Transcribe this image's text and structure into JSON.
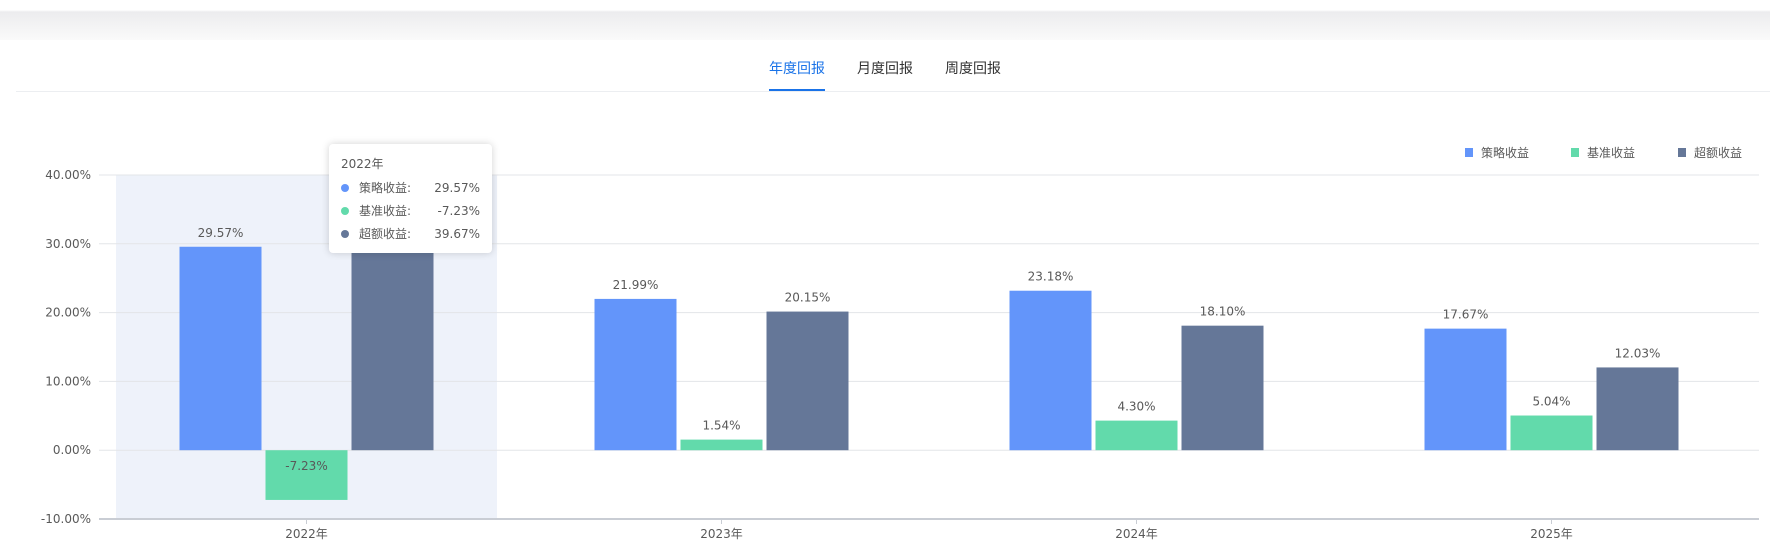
{
  "tabs": [
    {
      "label": "年度回报",
      "active": true
    },
    {
      "label": "月度回报",
      "active": false
    },
    {
      "label": "周度回报",
      "active": false
    }
  ],
  "tooltip": {
    "title": "2022年",
    "rows": [
      {
        "name": "策略收益:",
        "value": "29.57%"
      },
      {
        "name": "基准收益:",
        "value": "-7.23%"
      },
      {
        "name": "超额收益:",
        "value": "39.67%"
      }
    ]
  },
  "chart_data": {
    "type": "bar",
    "categories": [
      "2022年",
      "2023年",
      "2024年",
      "2025年"
    ],
    "series": [
      {
        "name": "策略收益",
        "color": "#6395fa",
        "values": [
          29.57,
          21.99,
          23.18,
          17.67
        ]
      },
      {
        "name": "基准收益",
        "color": "#62daab",
        "values": [
          -7.23,
          1.54,
          4.3,
          5.04
        ]
      },
      {
        "name": "超额收益",
        "color": "#657798",
        "values": [
          39.67,
          20.15,
          18.1,
          12.03
        ]
      }
    ],
    "yticks": [
      "40.00%",
      "30.00%",
      "20.00%",
      "10.00%",
      "0.00%",
      "-10.00%"
    ],
    "ylim": [
      -10,
      40
    ],
    "legend": "top-right",
    "highlighted_category": "2022年"
  }
}
